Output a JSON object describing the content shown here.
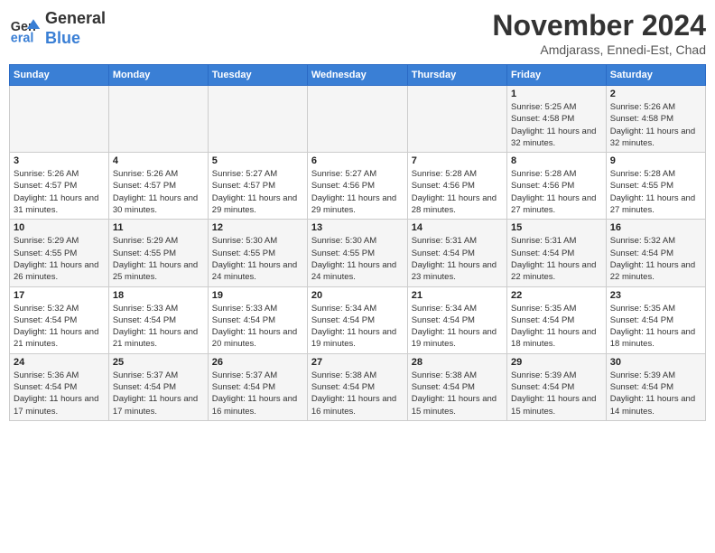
{
  "logo": {
    "line1": "General",
    "line2": "Blue"
  },
  "title": "November 2024",
  "subtitle": "Amdjarass, Ennedi-Est, Chad",
  "weekdays": [
    "Sunday",
    "Monday",
    "Tuesday",
    "Wednesday",
    "Thursday",
    "Friday",
    "Saturday"
  ],
  "weeks": [
    [
      {
        "day": "",
        "info": ""
      },
      {
        "day": "",
        "info": ""
      },
      {
        "day": "",
        "info": ""
      },
      {
        "day": "",
        "info": ""
      },
      {
        "day": "",
        "info": ""
      },
      {
        "day": "1",
        "info": "Sunrise: 5:25 AM\nSunset: 4:58 PM\nDaylight: 11 hours and 32 minutes."
      },
      {
        "day": "2",
        "info": "Sunrise: 5:26 AM\nSunset: 4:58 PM\nDaylight: 11 hours and 32 minutes."
      }
    ],
    [
      {
        "day": "3",
        "info": "Sunrise: 5:26 AM\nSunset: 4:57 PM\nDaylight: 11 hours and 31 minutes."
      },
      {
        "day": "4",
        "info": "Sunrise: 5:26 AM\nSunset: 4:57 PM\nDaylight: 11 hours and 30 minutes."
      },
      {
        "day": "5",
        "info": "Sunrise: 5:27 AM\nSunset: 4:57 PM\nDaylight: 11 hours and 29 minutes."
      },
      {
        "day": "6",
        "info": "Sunrise: 5:27 AM\nSunset: 4:56 PM\nDaylight: 11 hours and 29 minutes."
      },
      {
        "day": "7",
        "info": "Sunrise: 5:28 AM\nSunset: 4:56 PM\nDaylight: 11 hours and 28 minutes."
      },
      {
        "day": "8",
        "info": "Sunrise: 5:28 AM\nSunset: 4:56 PM\nDaylight: 11 hours and 27 minutes."
      },
      {
        "day": "9",
        "info": "Sunrise: 5:28 AM\nSunset: 4:55 PM\nDaylight: 11 hours and 27 minutes."
      }
    ],
    [
      {
        "day": "10",
        "info": "Sunrise: 5:29 AM\nSunset: 4:55 PM\nDaylight: 11 hours and 26 minutes."
      },
      {
        "day": "11",
        "info": "Sunrise: 5:29 AM\nSunset: 4:55 PM\nDaylight: 11 hours and 25 minutes."
      },
      {
        "day": "12",
        "info": "Sunrise: 5:30 AM\nSunset: 4:55 PM\nDaylight: 11 hours and 24 minutes."
      },
      {
        "day": "13",
        "info": "Sunrise: 5:30 AM\nSunset: 4:55 PM\nDaylight: 11 hours and 24 minutes."
      },
      {
        "day": "14",
        "info": "Sunrise: 5:31 AM\nSunset: 4:54 PM\nDaylight: 11 hours and 23 minutes."
      },
      {
        "day": "15",
        "info": "Sunrise: 5:31 AM\nSunset: 4:54 PM\nDaylight: 11 hours and 22 minutes."
      },
      {
        "day": "16",
        "info": "Sunrise: 5:32 AM\nSunset: 4:54 PM\nDaylight: 11 hours and 22 minutes."
      }
    ],
    [
      {
        "day": "17",
        "info": "Sunrise: 5:32 AM\nSunset: 4:54 PM\nDaylight: 11 hours and 21 minutes."
      },
      {
        "day": "18",
        "info": "Sunrise: 5:33 AM\nSunset: 4:54 PM\nDaylight: 11 hours and 21 minutes."
      },
      {
        "day": "19",
        "info": "Sunrise: 5:33 AM\nSunset: 4:54 PM\nDaylight: 11 hours and 20 minutes."
      },
      {
        "day": "20",
        "info": "Sunrise: 5:34 AM\nSunset: 4:54 PM\nDaylight: 11 hours and 19 minutes."
      },
      {
        "day": "21",
        "info": "Sunrise: 5:34 AM\nSunset: 4:54 PM\nDaylight: 11 hours and 19 minutes."
      },
      {
        "day": "22",
        "info": "Sunrise: 5:35 AM\nSunset: 4:54 PM\nDaylight: 11 hours and 18 minutes."
      },
      {
        "day": "23",
        "info": "Sunrise: 5:35 AM\nSunset: 4:54 PM\nDaylight: 11 hours and 18 minutes."
      }
    ],
    [
      {
        "day": "24",
        "info": "Sunrise: 5:36 AM\nSunset: 4:54 PM\nDaylight: 11 hours and 17 minutes."
      },
      {
        "day": "25",
        "info": "Sunrise: 5:37 AM\nSunset: 4:54 PM\nDaylight: 11 hours and 17 minutes."
      },
      {
        "day": "26",
        "info": "Sunrise: 5:37 AM\nSunset: 4:54 PM\nDaylight: 11 hours and 16 minutes."
      },
      {
        "day": "27",
        "info": "Sunrise: 5:38 AM\nSunset: 4:54 PM\nDaylight: 11 hours and 16 minutes."
      },
      {
        "day": "28",
        "info": "Sunrise: 5:38 AM\nSunset: 4:54 PM\nDaylight: 11 hours and 15 minutes."
      },
      {
        "day": "29",
        "info": "Sunrise: 5:39 AM\nSunset: 4:54 PM\nDaylight: 11 hours and 15 minutes."
      },
      {
        "day": "30",
        "info": "Sunrise: 5:39 AM\nSunset: 4:54 PM\nDaylight: 11 hours and 14 minutes."
      }
    ]
  ]
}
